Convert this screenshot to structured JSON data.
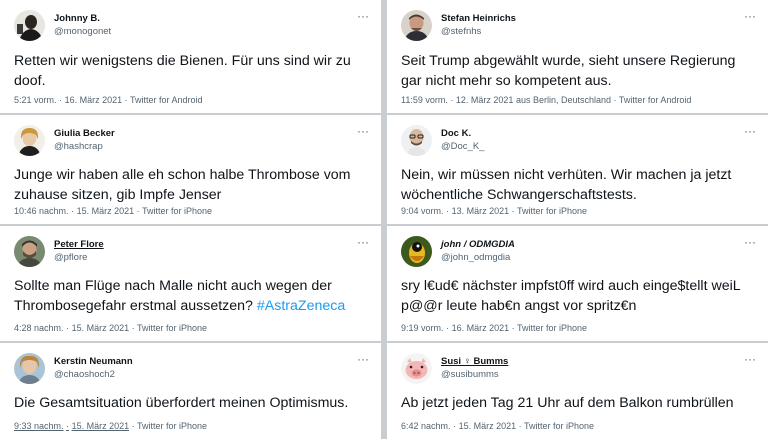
{
  "tweets": [
    {
      "name": "Johnny B.",
      "handle": "@monogonet",
      "text": "Retten wir wenigstens die Bienen. Für uns sind wir zu doof.",
      "time": "5:21 vorm.",
      "date": "16. März 2021",
      "location": "",
      "source": "Twitter for Android"
    },
    {
      "name": "Stefan Heinrichs",
      "handle": "@stefnhs",
      "text": "Seit Trump abgewählt wurde, sieht unsere Regierung gar nicht mehr so kompetent aus.",
      "time": "11:59 vorm.",
      "date": "12. März 2021",
      "location": "aus Berlin, Deutschland",
      "source": "Twitter for Android"
    },
    {
      "name": "Giulia Becker",
      "handle": "@hashcrap",
      "text": "Junge wir haben alle eh schon halbe Thrombose vom zuhause sitzen, gib Impfe Jenser",
      "time": "10:46 nachm.",
      "date": "15. März 2021",
      "location": "",
      "source": "Twitter for iPhone"
    },
    {
      "name": "Doc K.",
      "handle": "@Doc_K_",
      "text": "Nein, wir müssen nicht verhüten. Wir machen ja jetzt wöchentliche Schwangerschaftstests.",
      "time": "9:04 vorm.",
      "date": "13. März 2021",
      "location": "",
      "source": "Twitter for iPhone"
    },
    {
      "name": "Peter Flore",
      "handle": "@pflore",
      "text": "Sollte man Flüge nach Malle nicht auch wegen der Thrombosegefahr erstmal aussetzen?",
      "hashtag": "#AstraZeneca",
      "time": "4:28 nachm.",
      "date": "15. März 2021",
      "location": "",
      "source": "Twitter for iPhone"
    },
    {
      "name": "john / ODMGDIA",
      "handle": "@john_odmgdia",
      "text": "sry l€ud€ nächster impfst0ff wird auch einge$tellt weiL p@@r leute hab€n angst vor spritz€n",
      "time": "9:19 vorm.",
      "date": "16. März 2021",
      "location": "",
      "source": "Twitter for iPhone"
    },
    {
      "name": "Kerstin Neumann",
      "handle": "@chaoshoch2",
      "text": "Die Gesamtsituation überfordert meinen Optimismus.",
      "time": "9:33 nachm.",
      "date": "15. März 2021",
      "location": "",
      "source": "Twitter for iPhone"
    },
    {
      "name": "Susi ♀ Bumms",
      "handle": "@susibumms",
      "text": "Ab jetzt jeden Tag 21 Uhr auf dem Balkon rumbrüllen",
      "time": "6:42 nachm.",
      "date": "15. März 2021",
      "location": "",
      "source": "Twitter for iPhone"
    }
  ],
  "separator": "·",
  "more_icon": "···",
  "colors": {
    "name": "#0f1419",
    "secondary": "#536471",
    "hashtag": "#1d9bf0",
    "background": "#c9cdd1"
  },
  "icons": {
    "more": "more-horizontal-icon"
  }
}
